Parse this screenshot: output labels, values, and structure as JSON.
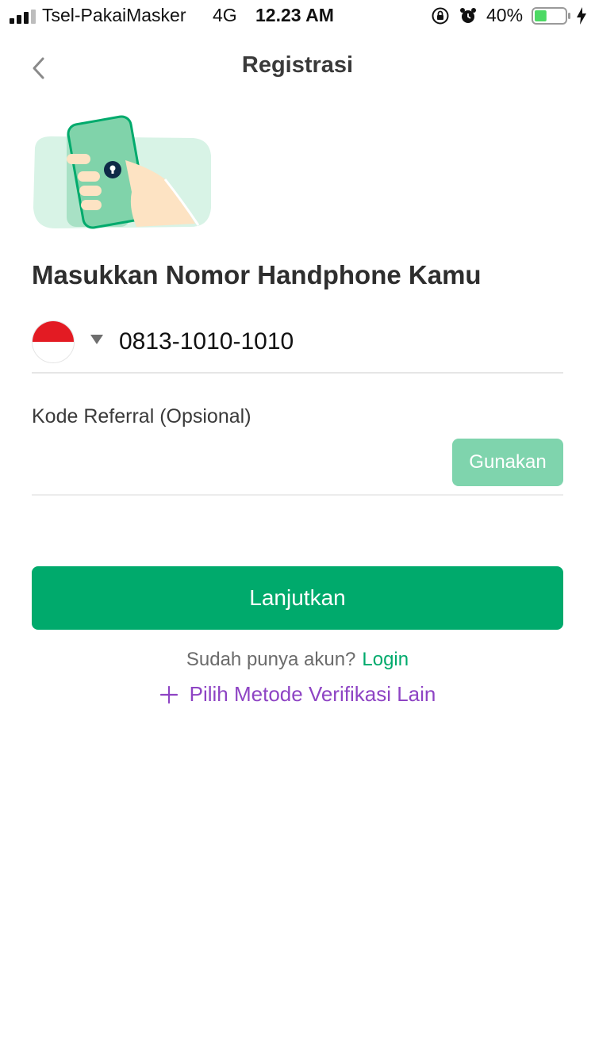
{
  "status_bar": {
    "carrier": "Tsel-PakaiMasker",
    "network": "4G",
    "time": "12.23 AM",
    "battery_percent": "40%",
    "battery_level": 0.4
  },
  "header": {
    "title": "Registrasi"
  },
  "main": {
    "heading": "Masukkan Nomor Handphone Kamu",
    "phone": {
      "value": "0813-1010-1010",
      "country_flag": "flag-indonesia-icon"
    },
    "referral": {
      "label": "Kode Referral (Opsional)",
      "value": "",
      "use_button": "Gunakan"
    },
    "continue_button": "Lanjutkan",
    "login_prompt": "Sudah punya akun?",
    "login_link": "Login",
    "alt_method": "Pilih Metode Verifikasi Lain"
  },
  "colors": {
    "primary": "#00aa6c",
    "primary_light": "#7fd4ad",
    "alt_link": "#8e44c4"
  }
}
